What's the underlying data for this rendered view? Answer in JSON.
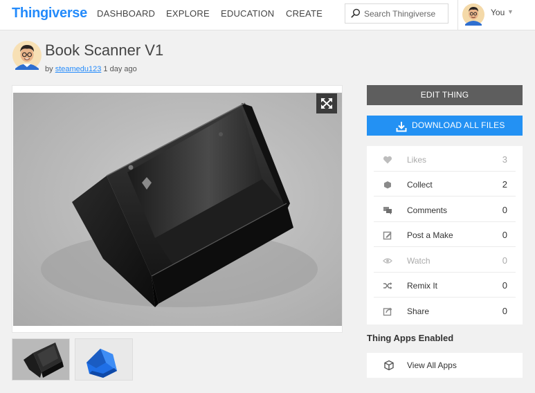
{
  "brand": {
    "logo_text": "Thingiverse",
    "accent": "#248bfb"
  },
  "nav": {
    "items": [
      {
        "label": "DASHBOARD"
      },
      {
        "label": "EXPLORE"
      },
      {
        "label": "EDUCATION"
      },
      {
        "label": "CREATE"
      }
    ],
    "search_placeholder": "Search Thingiverse",
    "user_label": "You"
  },
  "thing": {
    "title": "Book Scanner V1",
    "by_prefix": "by",
    "author": "steamedu123",
    "posted": "1 day ago"
  },
  "actions": {
    "edit_label": "EDIT THING",
    "download_label": "DOWNLOAD ALL FILES"
  },
  "stats": [
    {
      "label": "Likes",
      "count": "3",
      "icon": "heart-icon"
    },
    {
      "label": "Collect",
      "count": "2",
      "icon": "collect-icon"
    },
    {
      "label": "Comments",
      "count": "0",
      "icon": "comments-icon"
    },
    {
      "label": "Post a Make",
      "count": "0",
      "icon": "post-make-icon"
    },
    {
      "label": "Watch",
      "count": "0",
      "icon": "eye-icon"
    },
    {
      "label": "Remix It",
      "count": "0",
      "icon": "shuffle-icon"
    },
    {
      "label": "Share",
      "count": "0",
      "icon": "share-icon"
    }
  ],
  "apps": {
    "title": "Thing Apps Enabled",
    "view_all_label": "View All Apps"
  },
  "colors": {
    "edit_bg": "#5e5e5e",
    "download_bg": "#2391f3",
    "link": "#248bfb"
  }
}
